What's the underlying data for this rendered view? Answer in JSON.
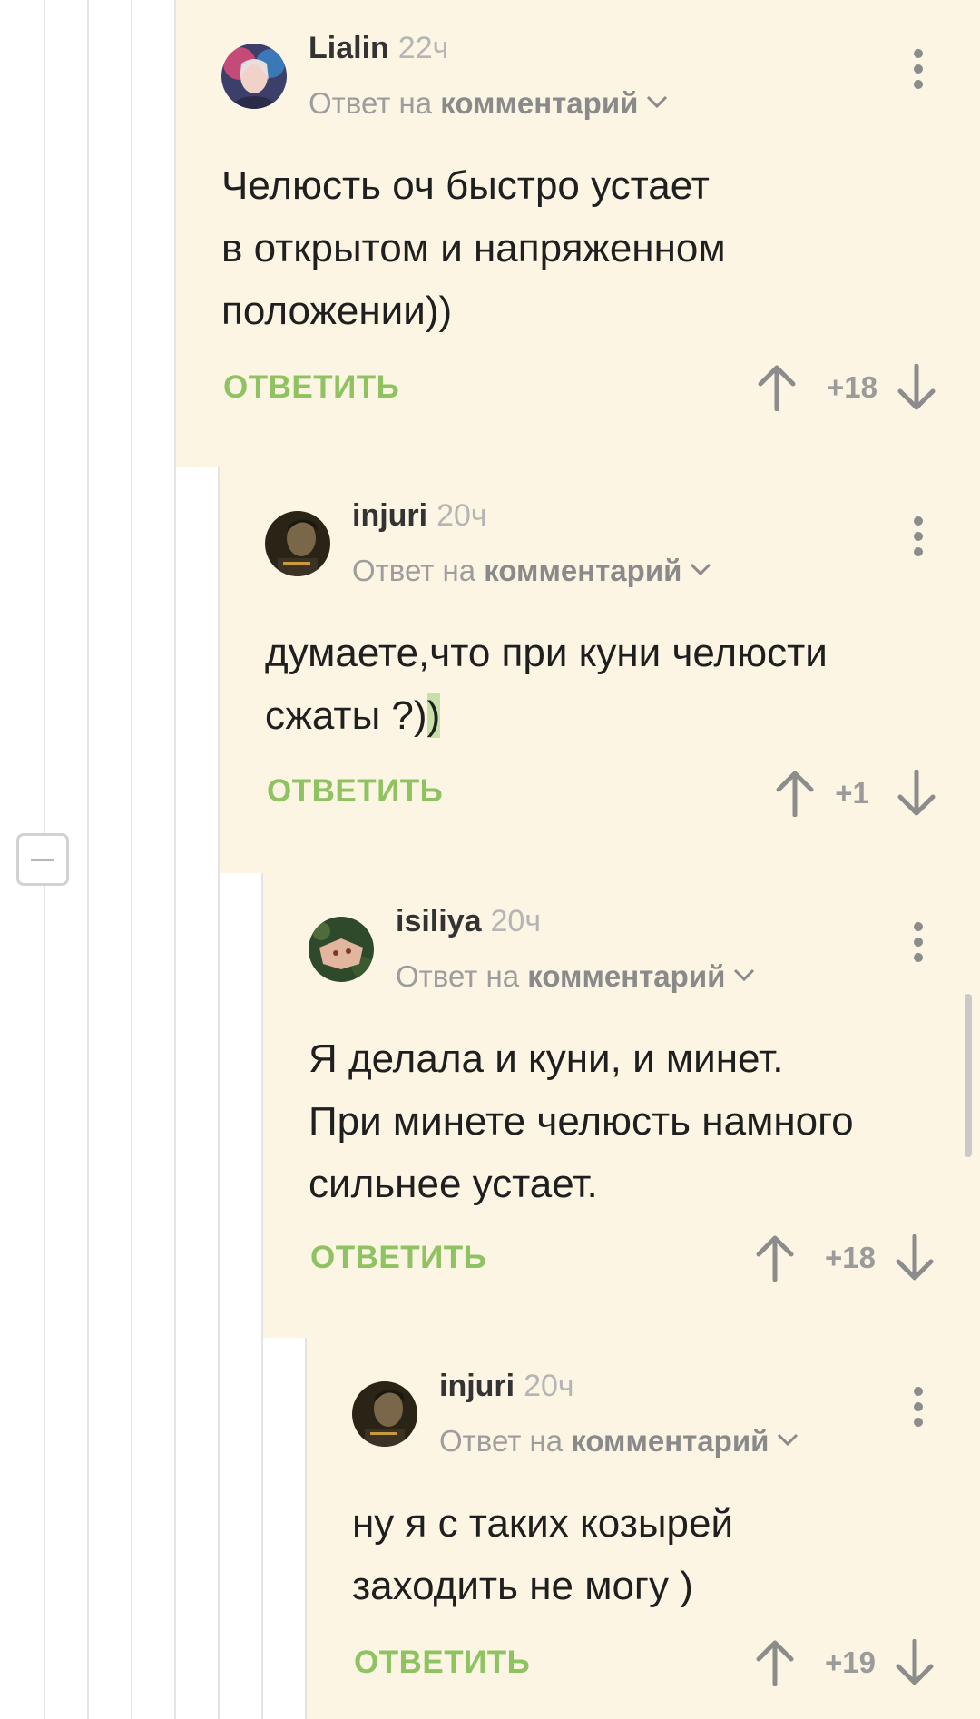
{
  "collapse_icon": "minus-square-icon",
  "comments": [
    {
      "author": "Lialin",
      "time": "22ч",
      "reply_prefix": "Ответ на",
      "reply_link": "комментарий",
      "text_lines": [
        "Челюсть оч быстро устает",
        "в открытом и напряженном",
        "положении))"
      ],
      "reply_label": "ОТВЕТИТЬ",
      "rating": "+18"
    },
    {
      "author": "injuri",
      "time": "20ч",
      "reply_prefix": "Ответ на",
      "reply_link": "комментарий",
      "text_lines": [
        "думаете,что при куни челюсти",
        "сжаты ?)"
      ],
      "text_highlight": ")",
      "reply_label": "ОТВЕТИТЬ",
      "rating": "+1"
    },
    {
      "author": "isiliya",
      "time": "20ч",
      "reply_prefix": "Ответ на",
      "reply_link": "комментарий",
      "text_lines": [
        "Я делала и куни, и минет.",
        "При минете челюсть намного",
        "сильнее устает."
      ],
      "reply_label": "ОТВЕТИТЬ",
      "rating": "+18"
    },
    {
      "author": "injuri",
      "time": "20ч",
      "reply_prefix": "Ответ на",
      "reply_link": "комментарий",
      "text_lines": [
        "ну я с таких козырей",
        "заходить не могу )"
      ],
      "reply_label": "ОТВЕТИТЬ",
      "rating": "+19"
    }
  ],
  "icons": {
    "menu": "more-vertical-icon",
    "upvote": "arrow-up-icon",
    "downvote": "arrow-down-icon",
    "expand": "chevron-down-icon"
  },
  "colors": {
    "comment_bg": "#fcf5e3",
    "reply_button": "#8fc361",
    "thread_line": "#e3e3e3"
  }
}
